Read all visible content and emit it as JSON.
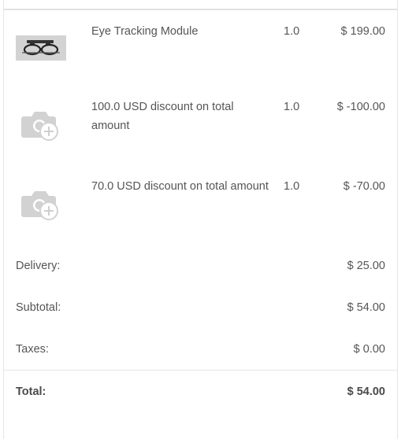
{
  "line_items": [
    {
      "image": "eye-tracker-glasses-photo",
      "name": "Eye Tracking Module",
      "quantity": "1.0",
      "price": "$ 199.00"
    },
    {
      "image": "camera-add-placeholder-icon",
      "name": "100.0 USD discount on total amount",
      "quantity": "1.0",
      "price": "$ -100.00"
    },
    {
      "image": "camera-add-placeholder-icon",
      "name": "70.0 USD discount on total amount",
      "quantity": "1.0",
      "price": "$ -70.00"
    }
  ],
  "summary": {
    "delivery_label": "Delivery:",
    "delivery_value": "$ 25.00",
    "subtotal_label": "Subtotal:",
    "subtotal_value": "$ 54.00",
    "taxes_label": "Taxes:",
    "taxes_value": "$ 0.00",
    "total_label": "Total:",
    "total_value": "$ 54.00"
  },
  "colors": {
    "text": "#555555",
    "border": "#e6e6e6",
    "placeholder": "#d0d0d0"
  }
}
